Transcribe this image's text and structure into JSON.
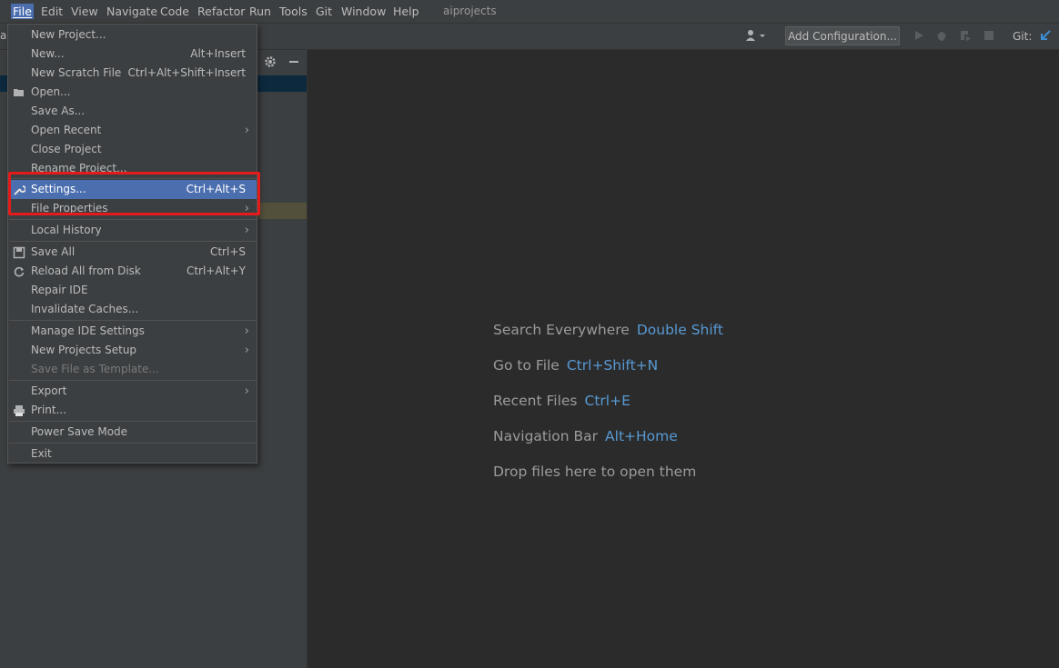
{
  "menubar": {
    "items": [
      "File",
      "Edit",
      "View",
      "Navigate",
      "Code",
      "Refactor",
      "Run",
      "Tools",
      "Git",
      "Window",
      "Help"
    ],
    "project": "aiprojects"
  },
  "toolbar": {
    "add_configuration": "Add Configuration...",
    "git_label": "Git:"
  },
  "sidebar": {
    "partial_label": "ai"
  },
  "file_menu": {
    "new_project": "New Project...",
    "new": "New...",
    "new_shortcut": "Alt+Insert",
    "new_scratch": "New Scratch File",
    "new_scratch_shortcut": "Ctrl+Alt+Shift+Insert",
    "open": "Open...",
    "save_as": "Save As...",
    "open_recent": "Open Recent",
    "close_project": "Close Project",
    "rename_project": "Rename Project...",
    "settings": "Settings...",
    "settings_shortcut": "Ctrl+Alt+S",
    "file_properties": "File Properties",
    "local_history": "Local History",
    "save_all": "Save All",
    "save_all_shortcut": "Ctrl+S",
    "reload_all": "Reload All from Disk",
    "reload_all_shortcut": "Ctrl+Alt+Y",
    "repair_ide": "Repair IDE",
    "invalidate_caches": "Invalidate Caches...",
    "manage_ide_settings": "Manage IDE Settings",
    "new_projects_setup": "New Projects Setup",
    "save_file_as_template": "Save File as Template...",
    "export": "Export",
    "print": "Print...",
    "power_save_mode": "Power Save Mode",
    "exit": "Exit"
  },
  "editor_hints": [
    {
      "label": "Search Everywhere",
      "key": "Double Shift"
    },
    {
      "label": "Go to File",
      "key": "Ctrl+Shift+N"
    },
    {
      "label": "Recent Files",
      "key": "Ctrl+E"
    },
    {
      "label": "Navigation Bar",
      "key": "Alt+Home"
    },
    {
      "label": "Drop files here to open them",
      "key": ""
    }
  ],
  "colors": {
    "accent": "#4b6eaf",
    "highlight_box": "#e51a1a",
    "shortcut_blue": "#5899d3"
  }
}
